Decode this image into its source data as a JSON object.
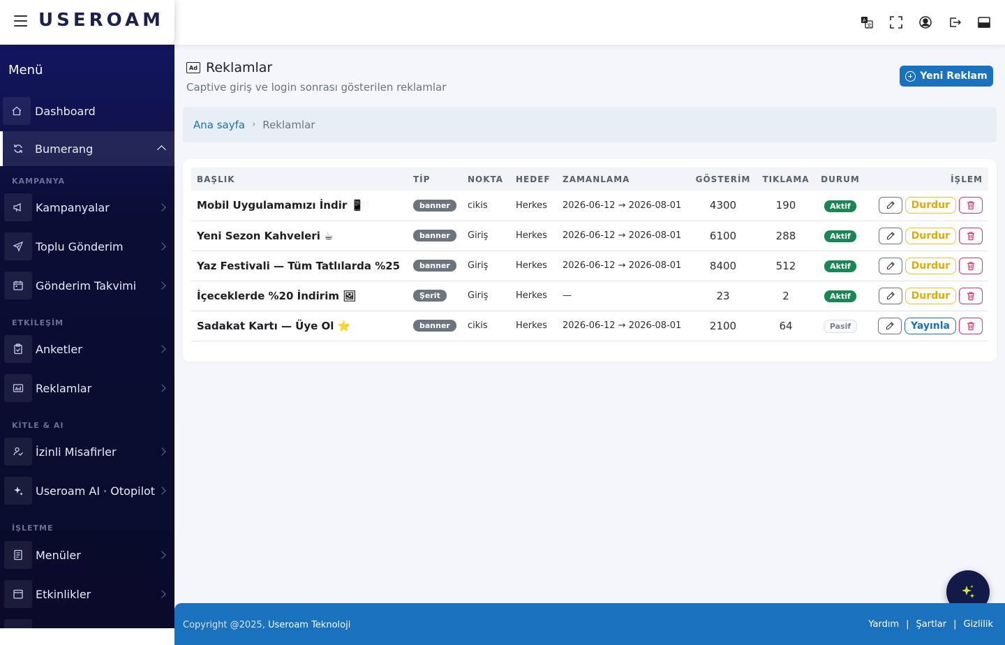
{
  "header": {
    "brand": "USEROAM",
    "icons": [
      "translate-icon",
      "fullscreen-icon",
      "user-icon",
      "logout-icon",
      "panel-icon"
    ]
  },
  "sidebar": {
    "title": "Menü",
    "items": [
      {
        "label": "Dashboard",
        "icon": "home-icon"
      },
      {
        "label": "Bumerang",
        "icon": "refresh-icon"
      },
      {
        "label": "Kampanyalar",
        "icon": "megaphone-icon"
      },
      {
        "label": "Toplu Gönderim",
        "icon": "send-icon"
      },
      {
        "label": "Gönderim Takvimi",
        "icon": "calendar-icon"
      },
      {
        "label": "Anketler",
        "icon": "clipboard-icon"
      },
      {
        "label": "Reklamlar",
        "icon": "ad-icon"
      },
      {
        "label": "İzinli Misafirler",
        "icon": "user-check-icon"
      },
      {
        "label": "Useroam AI · Otopilot",
        "icon": "sparkles-icon"
      },
      {
        "label": "Menüler",
        "icon": "menu-book-icon"
      },
      {
        "label": "Etkinlikler",
        "icon": "event-icon"
      }
    ],
    "sections": [
      "KAMPANYA",
      "ETKİLEŞİM",
      "KİTLE & AI",
      "İŞLETME"
    ]
  },
  "page": {
    "title": "Reklamlar",
    "subtitle": "Captive giriş ve login sonrası gösterilen reklamlar",
    "new_button": "Yeni Reklam"
  },
  "breadcrumb": {
    "home": "Ana sayfa",
    "separator": "›",
    "current": "Reklamlar"
  },
  "table": {
    "columns": [
      "BAŞLIK",
      "TİP",
      "NOKTA",
      "HEDEF",
      "ZAMANLAMA",
      "GÖSTERİM",
      "TIKLAMA",
      "DURUM",
      "İŞLEM"
    ],
    "rows": [
      {
        "title": "Mobil Uygulamamızı İndir 📱",
        "type": "banner",
        "point": "cikis",
        "target": "Herkes",
        "schedule": "2026-06-12 → 2026-08-01",
        "impressions": "4300",
        "clicks": "190",
        "status": "Aktif",
        "active": true,
        "toggle": "Durdur"
      },
      {
        "title": "Yeni Sezon Kahveleri ☕",
        "type": "banner",
        "point": "Giriş",
        "target": "Herkes",
        "schedule": "2026-06-12 → 2026-08-01",
        "impressions": "6100",
        "clicks": "288",
        "status": "Aktif",
        "active": true,
        "toggle": "Durdur"
      },
      {
        "title": "Yaz Festivali — Tüm Tatlılarda %25",
        "type": "banner",
        "point": "Giriş",
        "target": "Herkes",
        "schedule": "2026-06-12 → 2026-08-01",
        "impressions": "8400",
        "clicks": "512",
        "status": "Aktif",
        "active": true,
        "toggle": "Durdur"
      },
      {
        "title": "İçeceklerde %20 İndirim 🖼",
        "type": "Şerit",
        "point": "Giriş",
        "target": "Herkes",
        "schedule": "—",
        "impressions": "23",
        "clicks": "2",
        "status": "Aktif",
        "active": true,
        "toggle": "Durdur"
      },
      {
        "title": "Sadakat Kartı — Üye Ol ⭐",
        "type": "banner",
        "point": "cikis",
        "target": "Herkes",
        "schedule": "2026-06-12 → 2026-08-01",
        "impressions": "2100",
        "clicks": "64",
        "status": "Pasif",
        "active": false,
        "toggle": "Yayınla"
      }
    ]
  },
  "footer": {
    "copyright": "Copyright @2025,",
    "company": "Useroam Teknoloji",
    "links": [
      "Yardım",
      "Şartlar",
      "Gizlilik"
    ],
    "separator": "|"
  },
  "colors": {
    "primary": "#1a72be",
    "sidebar": "#0b0d35",
    "success": "#198754",
    "warning": "#e0ac00",
    "danger": "#d63a6a"
  }
}
